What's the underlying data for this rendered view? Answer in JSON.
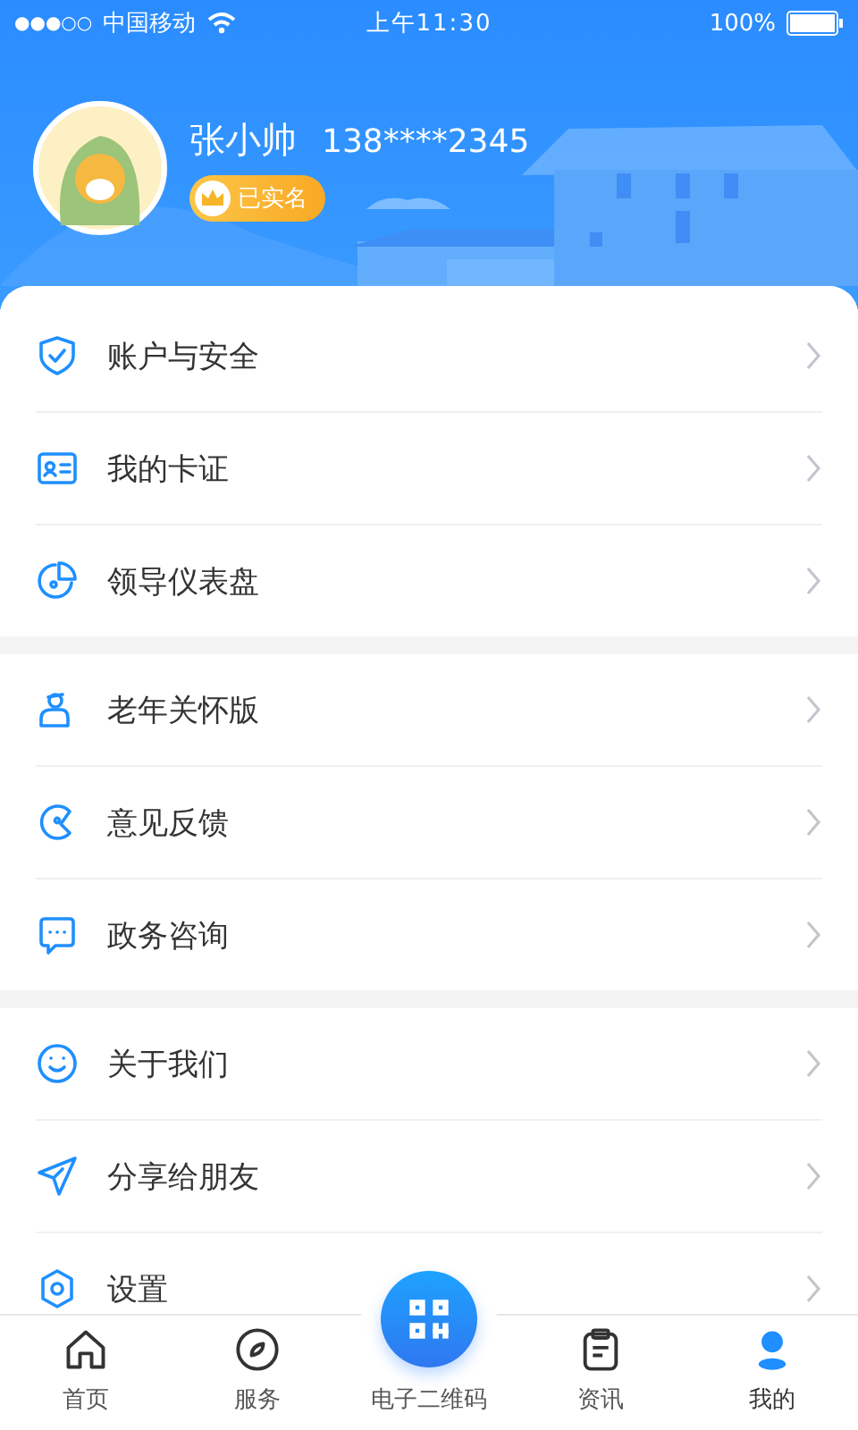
{
  "status_bar": {
    "signal": "●●●○○",
    "carrier": "中国移动",
    "time": "上午11:30",
    "battery": "100%"
  },
  "profile": {
    "name": "张小帅",
    "phone": "138****2345",
    "badge": "已实名"
  },
  "groups": [
    [
      {
        "label": "账户与安全"
      },
      {
        "label": "我的卡证"
      },
      {
        "label": "领导仪表盘"
      }
    ],
    [
      {
        "label": "老年关怀版"
      },
      {
        "label": "意见反馈"
      },
      {
        "label": "政务咨询"
      }
    ],
    [
      {
        "label": "关于我们"
      },
      {
        "label": "分享给朋友"
      },
      {
        "label": "设置"
      }
    ]
  ],
  "tabs": [
    {
      "label": "首页",
      "kind": "normal",
      "selected": false
    },
    {
      "label": "服务",
      "kind": "normal",
      "selected": false
    },
    {
      "label": "电子二维码",
      "kind": "center",
      "selected": false
    },
    {
      "label": "资讯",
      "kind": "normal",
      "selected": false
    },
    {
      "label": "我的",
      "kind": "normal",
      "selected": true
    }
  ]
}
